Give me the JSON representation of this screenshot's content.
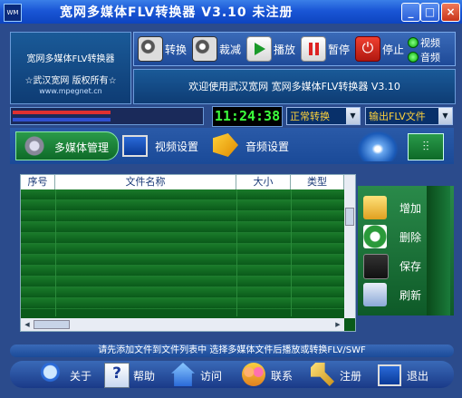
{
  "window": {
    "title": "宽网多媒体FLV转换器  V3.10 未注册",
    "icon_label": "WM",
    "controls": {
      "minimize": "_",
      "maximize": "□",
      "close": "×"
    }
  },
  "logo": {
    "product": "宽网多媒体FLV转换器",
    "copyright": "☆武汉宽网 版权所有☆",
    "url": "www.mpegnet.cn"
  },
  "toolbar": {
    "convert": "转换",
    "trim": "裁减",
    "play": "播放",
    "pause": "暂停",
    "stop": "停止",
    "mode_video": "视频",
    "mode_audio": "音频"
  },
  "welcome_text": "欢迎使用武汉宽网 宽网多媒体FLV转换器 V3.10",
  "progress": {
    "bar1": 0.0,
    "bar2": 0.0
  },
  "clock": "11:24:38",
  "convert_mode": {
    "selected": "正常转换"
  },
  "output_type": {
    "selected": "输出FLV文件"
  },
  "tabs": {
    "media": "多媒体管理",
    "video": "视频设置",
    "audio": "音频设置"
  },
  "file_list": {
    "columns": [
      "序号",
      "文件名称",
      "大小",
      "类型"
    ],
    "rows": []
  },
  "side_buttons": {
    "add": "增加",
    "delete": "删除",
    "save": "保存",
    "refresh": "刷新"
  },
  "status_message": "请先添加文件到文件列表中 选择多媒体文件后播放或转换FLV/SWF",
  "bottom": {
    "about": "关于",
    "help": "帮助",
    "visit": "访问",
    "contact": "联系",
    "register": "注册",
    "exit": "退出"
  }
}
